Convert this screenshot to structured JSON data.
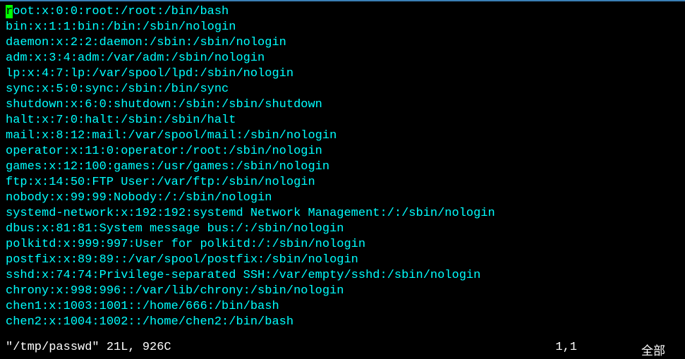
{
  "cursor": {
    "line": 0,
    "col": 0,
    "char": "r"
  },
  "lines": [
    "root:x:0:0:root:/root:/bin/bash",
    "bin:x:1:1:bin:/bin:/sbin/nologin",
    "daemon:x:2:2:daemon:/sbin:/sbin/nologin",
    "adm:x:3:4:adm:/var/adm:/sbin/nologin",
    "lp:x:4:7:lp:/var/spool/lpd:/sbin/nologin",
    "sync:x:5:0:sync:/sbin:/bin/sync",
    "shutdown:x:6:0:shutdown:/sbin:/sbin/shutdown",
    "halt:x:7:0:halt:/sbin:/sbin/halt",
    "mail:x:8:12:mail:/var/spool/mail:/sbin/nologin",
    "operator:x:11:0:operator:/root:/sbin/nologin",
    "games:x:12:100:games:/usr/games:/sbin/nologin",
    "ftp:x:14:50:FTP User:/var/ftp:/sbin/nologin",
    "nobody:x:99:99:Nobody:/:/sbin/nologin",
    "systemd-network:x:192:192:systemd Network Management:/:/sbin/nologin",
    "dbus:x:81:81:System message bus:/:/sbin/nologin",
    "polkitd:x:999:997:User for polkitd:/:/sbin/nologin",
    "postfix:x:89:89::/var/spool/postfix:/sbin/nologin",
    "sshd:x:74:74:Privilege-separated SSH:/var/empty/sshd:/sbin/nologin",
    "chrony:x:998:996::/var/lib/chrony:/sbin/nologin",
    "chen1:x:1003:1001::/home/666:/bin/bash",
    "chen2:x:1004:1002::/home/chen2:/bin/bash"
  ],
  "status": {
    "file_info": "\"/tmp/passwd\" 21L, 926C",
    "position": "1,1",
    "scroll": "全部"
  }
}
